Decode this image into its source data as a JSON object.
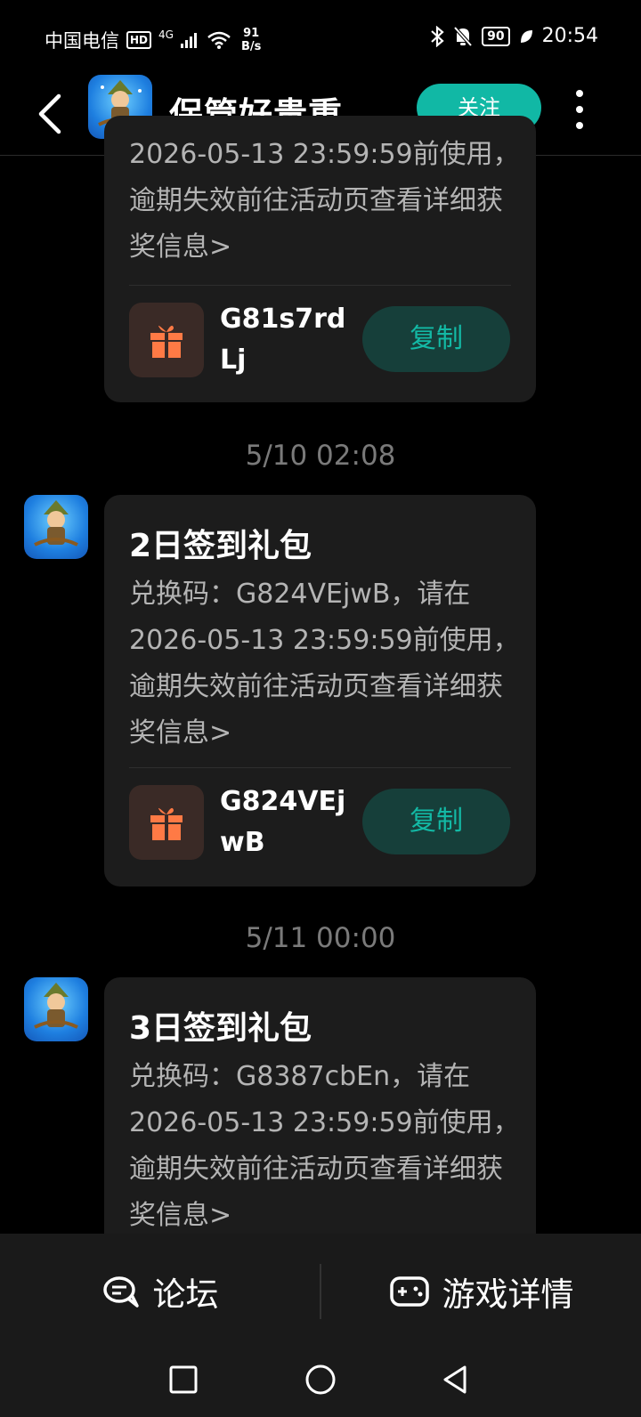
{
  "status_bar": {
    "carrier": "中国电信",
    "hd": "HD",
    "signal": "4G",
    "net_speed_value": "91",
    "net_speed_unit": "B/s",
    "battery": "90",
    "time": "20:54"
  },
  "header": {
    "title": "保管好贵重...",
    "follow_label": "关注"
  },
  "messages": [
    {
      "body_partial": "2026-05-13 23:59:59前使用，逾期失效前往活动页查看详细获奖信息>",
      "code": "G81s7rdLj",
      "copy_label": "复制"
    },
    {
      "time": "5/10  02:08",
      "title": "2日签到礼包",
      "body": "兑换码：G824VEjwB，请在2026-05-13 23:59:59前使用，逾期失效前往活动页查看详细获奖信息>",
      "code": "G824VEjwB",
      "copy_label": "复制"
    },
    {
      "time": "5/11  00:00",
      "title": "3日签到礼包",
      "body": "兑换码：G8387cbEn，请在2026-05-13 23:59:59前使用，逾期失效前往活动页查看详细获奖信息>"
    }
  ],
  "bottom_tabs": {
    "forum_label": "论坛",
    "game_details_label": "游戏详情"
  },
  "colors": {
    "accent": "#11b8a5",
    "card_bg": "#1c1c1c",
    "copy_bg": "#163f3a",
    "gift_orange": "#ff7a45"
  }
}
